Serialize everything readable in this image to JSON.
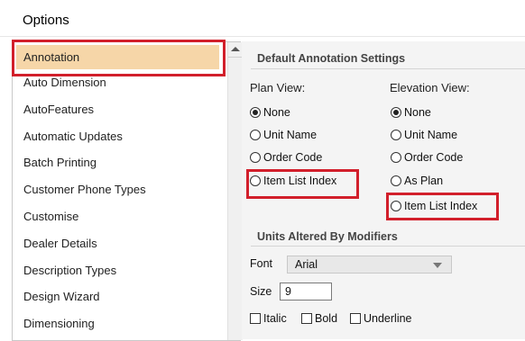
{
  "window": {
    "title": "Options"
  },
  "sidebar": {
    "items": [
      {
        "label": "Annotation",
        "selected": true
      },
      {
        "label": "Auto Dimension"
      },
      {
        "label": "AutoFeatures"
      },
      {
        "label": "Automatic Updates"
      },
      {
        "label": "Batch Printing"
      },
      {
        "label": "Customer Phone Types"
      },
      {
        "label": "Customise"
      },
      {
        "label": "Dealer Details"
      },
      {
        "label": "Description Types"
      },
      {
        "label": "Design Wizard"
      },
      {
        "label": "Dimensioning"
      }
    ]
  },
  "default_annotation": {
    "title": "Default Annotation Settings",
    "plan_view": {
      "label": "Plan View:",
      "options": [
        {
          "label": "None",
          "checked": true
        },
        {
          "label": "Unit Name",
          "checked": false
        },
        {
          "label": "Order Code",
          "checked": false
        },
        {
          "label": "Item List Index",
          "checked": false
        }
      ]
    },
    "elevation_view": {
      "label": "Elevation View:",
      "options": [
        {
          "label": "None",
          "checked": true
        },
        {
          "label": "Unit Name",
          "checked": false
        },
        {
          "label": "Order Code",
          "checked": false
        },
        {
          "label": "As Plan",
          "checked": false
        },
        {
          "label": "Item List Index",
          "checked": false
        }
      ]
    }
  },
  "units_altered": {
    "title": "Units Altered By Modifiers",
    "font_label": "Font",
    "font_value": "Arial",
    "size_label": "Size",
    "size_value": "9",
    "italic_label": "Italic",
    "bold_label": "Bold",
    "underline_label": "Underline"
  },
  "colors": {
    "highlight": "#d21f2b",
    "selection": "#f6d6a8",
    "pane_bg": "#f4f4f4"
  }
}
